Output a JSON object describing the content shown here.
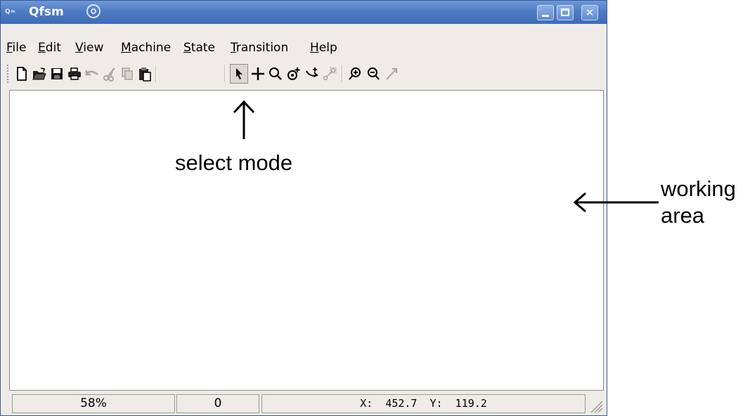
{
  "window": {
    "title": "Qfsm",
    "app_icon_text": "Q≈"
  },
  "menu": [
    {
      "label": "File",
      "mnemonic": "F",
      "rest": "ile"
    },
    {
      "label": "Edit",
      "mnemonic": "E",
      "rest": "dit"
    },
    {
      "label": "View",
      "mnemonic": "V",
      "rest": "iew"
    },
    {
      "label": "Machine",
      "mnemonic": "M",
      "rest": "achine"
    },
    {
      "label": "State",
      "mnemonic": "S",
      "rest": "tate"
    },
    {
      "label": "Transition",
      "mnemonic": "T",
      "rest": "ransition"
    },
    {
      "label": "Help",
      "mnemonic": "H",
      "rest": "elp"
    }
  ],
  "toolbar": {
    "buttons": [
      {
        "name": "new-file-icon",
        "enabled": true
      },
      {
        "name": "open-folder-icon",
        "enabled": true
      },
      {
        "name": "save-icon",
        "enabled": true
      },
      {
        "name": "print-icon",
        "enabled": true
      },
      {
        "name": "undo-icon",
        "enabled": false
      },
      {
        "name": "cut-icon",
        "enabled": false
      },
      {
        "name": "copy-icon",
        "enabled": false
      },
      {
        "name": "paste-icon",
        "enabled": true
      },
      {
        "name": "select-arrow-icon",
        "enabled": true,
        "pressed": true
      },
      {
        "name": "pan-icon",
        "enabled": true
      },
      {
        "name": "zoom-icon",
        "enabled": true
      },
      {
        "name": "add-state-icon",
        "enabled": true
      },
      {
        "name": "add-transition-icon",
        "enabled": true
      },
      {
        "name": "straighten-transition-icon",
        "enabled": false
      },
      {
        "name": "zoom-in-icon",
        "enabled": true
      },
      {
        "name": "zoom-out-icon",
        "enabled": true
      },
      {
        "name": "simulate-icon",
        "enabled": false
      }
    ]
  },
  "statusbar": {
    "zoom": "58%",
    "count": "0",
    "x_label": "X:",
    "x_value": "452.7",
    "y_label": "Y:",
    "y_value": "119.2"
  },
  "annotations": {
    "select_mode": "select mode",
    "working_line1": "working",
    "working_line2": "area"
  },
  "colors": {
    "titlebar": "#4e7cc4",
    "window_bg": "#efebe7",
    "workarea_bg": "#ffffff"
  }
}
